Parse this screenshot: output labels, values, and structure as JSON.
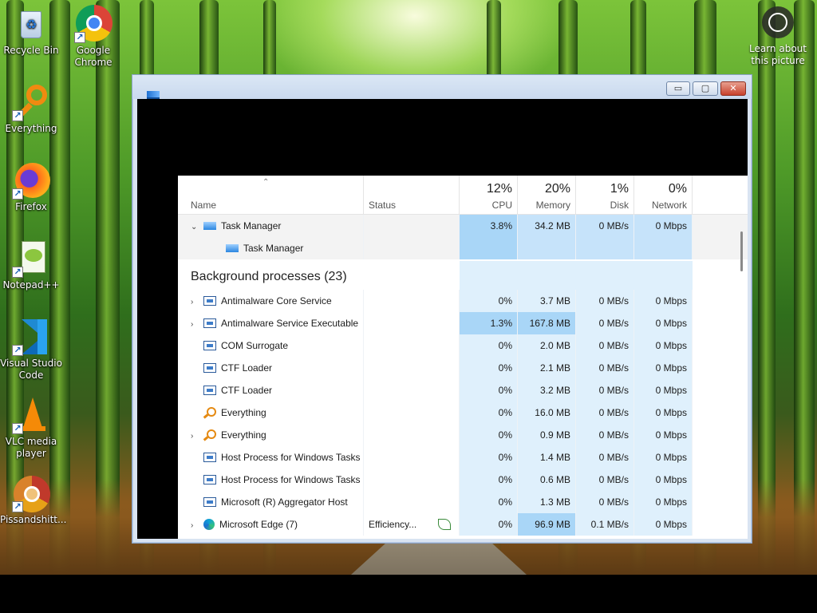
{
  "desktop": {
    "icons": [
      {
        "label": "Recycle Bin",
        "icon": "recycle-bin-icon",
        "shortcut": false
      },
      {
        "label": "Google Chrome",
        "icon": "chrome-icon",
        "shortcut": true
      },
      {
        "label": "Everything",
        "icon": "everything-icon",
        "shortcut": true
      },
      {
        "label": "Firefox",
        "icon": "firefox-icon",
        "shortcut": true
      },
      {
        "label": "Notepad++",
        "icon": "notepadpp-icon",
        "shortcut": true
      },
      {
        "label": "Visual Studio Code",
        "icon": "vscode-icon",
        "shortcut": true
      },
      {
        "label": "VLC media player",
        "icon": "vlc-icon",
        "shortcut": true
      },
      {
        "label": "Pissandshitt...",
        "icon": "chrome-app-icon",
        "shortcut": true
      }
    ],
    "learn": {
      "label": "Learn about this picture",
      "icon": "camera-icon"
    }
  },
  "window": {
    "controls": {
      "minimize": "▭",
      "maximize": "▢",
      "close": "✕"
    }
  },
  "table": {
    "sort_indicator": "⌃",
    "headers": {
      "name": "Name",
      "status": "Status",
      "cpu": {
        "pct": "12%",
        "label": "CPU"
      },
      "memory": {
        "pct": "20%",
        "label": "Memory"
      },
      "disk": {
        "pct": "1%",
        "label": "Disk"
      },
      "network": {
        "pct": "0%",
        "label": "Network"
      }
    },
    "apps": [
      {
        "name": "Task Manager",
        "expanded": true,
        "icon": "task-manager-icon",
        "status": "",
        "cpu": "3.8%",
        "memory": "34.2 MB",
        "disk": "0 MB/s",
        "network": "0 Mbps"
      },
      {
        "name": "Task Manager",
        "child": true,
        "icon": "task-manager-icon",
        "status": "",
        "cpu": "",
        "memory": "",
        "disk": "",
        "network": ""
      }
    ],
    "group_title": "Background processes (23)",
    "processes": [
      {
        "name": "Antimalware Core Service",
        "expandable": true,
        "icon": "service-icon",
        "status": "",
        "cpu": "0%",
        "memory": "3.7 MB",
        "disk": "0 MB/s",
        "network": "0 Mbps"
      },
      {
        "name": "Antimalware Service Executable",
        "expandable": true,
        "icon": "service-icon",
        "status": "",
        "cpu": "1.3%",
        "memory": "167.8 MB",
        "disk": "0 MB/s",
        "network": "0 Mbps"
      },
      {
        "name": "COM Surrogate",
        "expandable": false,
        "icon": "service-icon",
        "status": "",
        "cpu": "0%",
        "memory": "2.0 MB",
        "disk": "0 MB/s",
        "network": "0 Mbps"
      },
      {
        "name": "CTF Loader",
        "expandable": false,
        "icon": "service-icon",
        "status": "",
        "cpu": "0%",
        "memory": "2.1 MB",
        "disk": "0 MB/s",
        "network": "0 Mbps"
      },
      {
        "name": "CTF Loader",
        "expandable": false,
        "icon": "service-icon",
        "status": "",
        "cpu": "0%",
        "memory": "3.2 MB",
        "disk": "0 MB/s",
        "network": "0 Mbps"
      },
      {
        "name": "Everything",
        "expandable": false,
        "icon": "everything-icon",
        "status": "",
        "cpu": "0%",
        "memory": "16.0 MB",
        "disk": "0 MB/s",
        "network": "0 Mbps"
      },
      {
        "name": "Everything",
        "expandable": true,
        "icon": "everything-icon",
        "status": "",
        "cpu": "0%",
        "memory": "0.9 MB",
        "disk": "0 MB/s",
        "network": "0 Mbps"
      },
      {
        "name": "Host Process for Windows Tasks",
        "expandable": false,
        "icon": "service-icon",
        "status": "",
        "cpu": "0%",
        "memory": "1.4 MB",
        "disk": "0 MB/s",
        "network": "0 Mbps"
      },
      {
        "name": "Host Process for Windows Tasks",
        "expandable": false,
        "icon": "service-icon",
        "status": "",
        "cpu": "0%",
        "memory": "0.6 MB",
        "disk": "0 MB/s",
        "network": "0 Mbps"
      },
      {
        "name": "Microsoft (R) Aggregator Host",
        "expandable": false,
        "icon": "service-icon",
        "status": "",
        "cpu": "0%",
        "memory": "1.3 MB",
        "disk": "0 MB/s",
        "network": "0 Mbps"
      },
      {
        "name": "Microsoft Edge (7)",
        "expandable": true,
        "icon": "edge-icon",
        "status": "Efficiency...",
        "status_icon": "leaf-icon",
        "cpu": "0%",
        "memory": "96.9 MB",
        "disk": "0.1 MB/s",
        "network": "0 Mbps"
      }
    ]
  }
}
